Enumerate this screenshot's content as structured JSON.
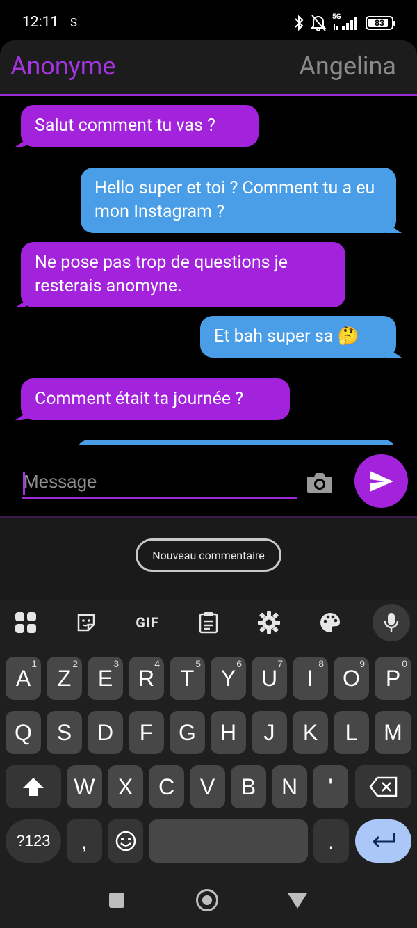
{
  "status_bar": {
    "time": "12:11",
    "extra": "S",
    "network": "5G",
    "battery": "83"
  },
  "header": {
    "left_name": "Anonyme",
    "right_name": "Angelina"
  },
  "messages": [
    {
      "direction": "in",
      "text": "Salut comment tu vas ?"
    },
    {
      "direction": "out",
      "text": "Hello super et toi ? Comment tu a eu mon Instagram ?"
    },
    {
      "direction": "in",
      "text": "Ne pose pas trop de questions je resterais anomyne."
    },
    {
      "direction": "out",
      "text": "Et bah super sa 🤔"
    },
    {
      "direction": "in",
      "text": "Comment était ta journée ?"
    }
  ],
  "composer": {
    "placeholder": "Message"
  },
  "suggestion": {
    "chip_label": "Nouveau commentaire"
  },
  "keyboard": {
    "toolbar": [
      "apps-icon",
      "sticker-icon",
      "GIF",
      "clipboard-icon",
      "gear-icon",
      "palette-icon",
      "mic-icon"
    ],
    "gif_label": "GIF",
    "row1": [
      {
        "k": "A",
        "h": "1"
      },
      {
        "k": "Z",
        "h": "2"
      },
      {
        "k": "E",
        "h": "3"
      },
      {
        "k": "R",
        "h": "4"
      },
      {
        "k": "T",
        "h": "5"
      },
      {
        "k": "Y",
        "h": "6"
      },
      {
        "k": "U",
        "h": "7"
      },
      {
        "k": "I",
        "h": "8"
      },
      {
        "k": "O",
        "h": "9"
      },
      {
        "k": "P",
        "h": "0"
      }
    ],
    "row2": [
      "Q",
      "S",
      "D",
      "F",
      "G",
      "H",
      "J",
      "K",
      "L",
      "M"
    ],
    "row3": [
      "W",
      "X",
      "C",
      "V",
      "B",
      "N",
      "'"
    ],
    "symbols_label": "?123",
    "comma": ",",
    "period": "."
  },
  "colors": {
    "accent": "#a223db",
    "outgoing": "#4a9ee8",
    "enter": "#aac7f8"
  }
}
